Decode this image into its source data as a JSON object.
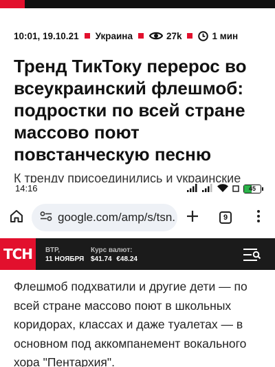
{
  "article": {
    "datetime": "10:01, 19.10.21",
    "category": "Украина",
    "views": "27k",
    "read_time": "1 мин",
    "headline": "Тренд ТикТоку перерос во всеукраинский флешмоб: подростки по всей стране массово поют повстанческую песню",
    "cut_line": "К тренду присоединились и украинские"
  },
  "status_bar": {
    "time": "14:16",
    "battery": "45",
    "battery_level": 0.45
  },
  "browser": {
    "url": "google.com/amp/s/tsn.u",
    "tab_count": "9",
    "icons": [
      "home-icon",
      "site-info-icon",
      "new-tab-plus-icon",
      "tab-switcher-icon",
      "more-vert-icon"
    ]
  },
  "tsn_header": {
    "logo": "ТСН",
    "weekday": "ВТР,",
    "date": "11 НОЯБРЯ",
    "rates_label": "Курс валют:",
    "usd": "$41.74",
    "eur": "€48.24"
  },
  "body_text": "Флешмоб подхватили и другие дети — по всей стране массово поют в школьных коридорах, классах и даже туалетах — в основном под аккомпанемент вокального хора \"Пентархия\".",
  "colors": {
    "brand_red": "#e2102d",
    "header_dark": "#1b1b1b",
    "battery_green": "#2cb34a"
  }
}
